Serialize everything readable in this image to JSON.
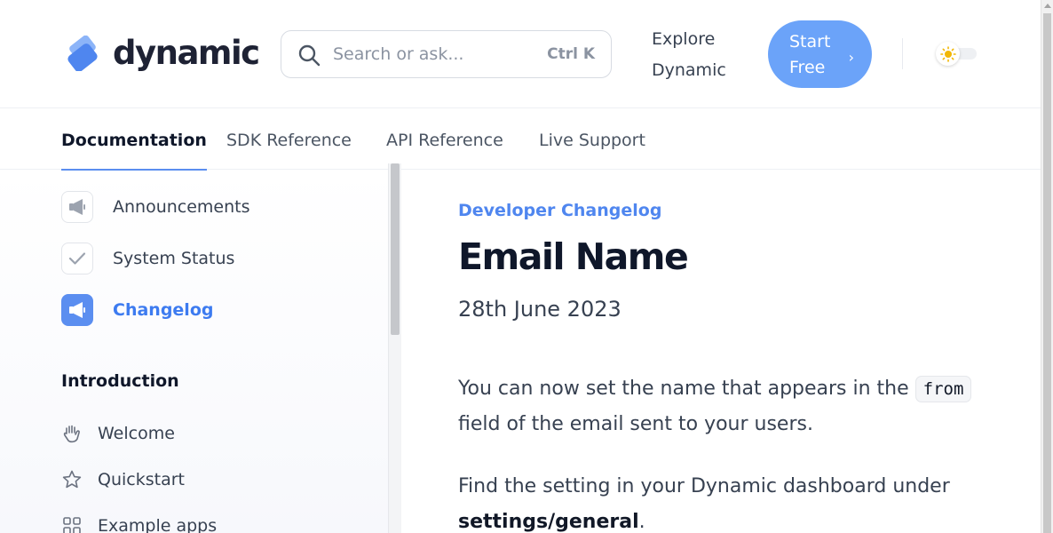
{
  "brand": {
    "name": "dynamic",
    "logo_icon": "dynamic-logo-icon",
    "accent": "#5b8ef0",
    "button_color": "#6ba3f9"
  },
  "search": {
    "placeholder": "Search or ask...",
    "value": "",
    "shortcut": "Ctrl K",
    "icon": "search-icon"
  },
  "header": {
    "explore_line1": "Explore",
    "explore_line2": "Dynamic",
    "start_line1": "Start",
    "start_line2": "Free",
    "start_chevron": "›",
    "theme_toggle_icon": "sun-icon"
  },
  "tabs": [
    {
      "label": "Documentation",
      "active": true
    },
    {
      "label": "SDK Reference",
      "active": false
    },
    {
      "label": "API Reference",
      "active": false
    },
    {
      "label": "Live Support",
      "active": false
    }
  ],
  "sidebar": {
    "links": [
      {
        "label": "Announcements",
        "icon": "megaphone-icon",
        "active": false
      },
      {
        "label": "System Status",
        "icon": "check-icon",
        "active": false
      },
      {
        "label": "Changelog",
        "icon": "megaphone-icon",
        "active": true
      }
    ],
    "section_title": "Introduction",
    "items": [
      {
        "label": "Welcome",
        "icon": "waving-hand-icon"
      },
      {
        "label": "Quickstart",
        "icon": "star-icon"
      },
      {
        "label": "Example apps",
        "icon": "grid-icon"
      }
    ]
  },
  "main": {
    "eyebrow": "Developer Changelog",
    "title": "Email Name",
    "date": "28th June 2023",
    "p1_before": "You can now set the name that appears in the ",
    "p1_code": "from",
    "p1_after": " field of the email sent to your users.",
    "p2_before": "Find the setting in your Dynamic dashboard under ",
    "p2_bold": "settings/general",
    "p2_after": "."
  }
}
